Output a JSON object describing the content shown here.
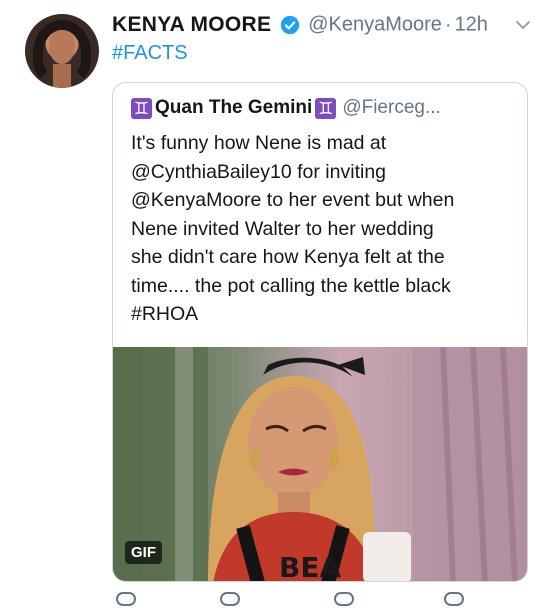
{
  "tweet": {
    "author_name": "KENYA MOORE",
    "handle": "@KenyaMoore",
    "separator": "·",
    "time": "12h",
    "text": "#FACTS",
    "icons": {
      "avatar": "avatar",
      "verified": "verified-badge-icon",
      "menu": "chevron-down-icon"
    },
    "accent_color": "#1b95e0"
  },
  "quoted": {
    "name": "Quan The Gemini",
    "gemini_glyph": "♊",
    "handle": "@Fierceg...",
    "lines": [
      "It's funny how Nene is mad at",
      "@CynthiaBailey10 for inviting",
      "@KenyaMoore to her event  but when",
      "Nene invited Walter to her wedding",
      "she didn't care how Kenya felt at the",
      "time.... the pot calling the kettle black",
      "#RHOA"
    ],
    "media": {
      "type": "gif",
      "badge": "GIF",
      "shirt_text": "BEA"
    }
  }
}
